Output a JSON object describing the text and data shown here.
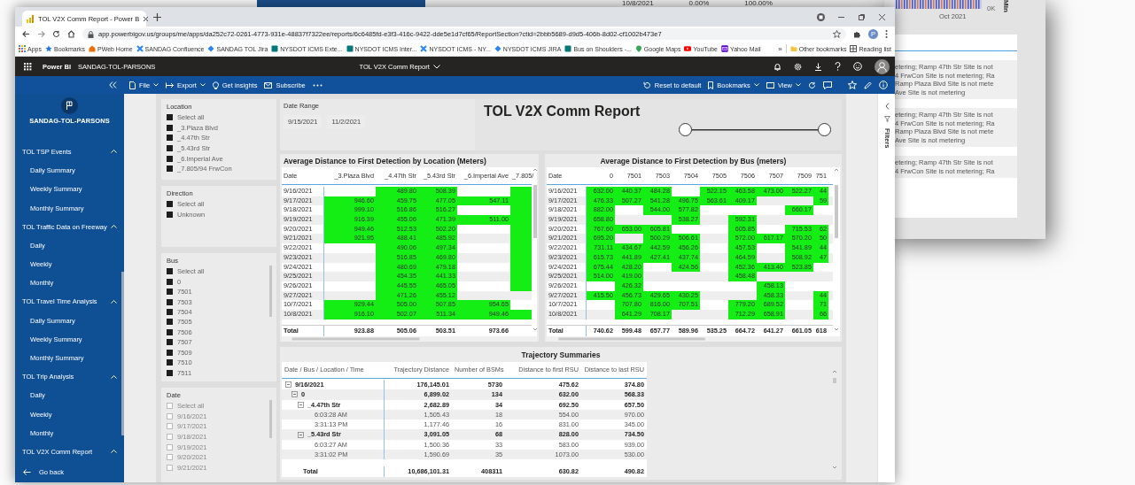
{
  "background": {
    "top_strip": [
      "10/8/2021",
      "0.00%",
      "100.00%"
    ],
    "side_panel": {
      "axis_label": "Oct 2021",
      "value_label": "0K",
      "axis_title": "Min",
      "messages": [
        [
          "etering; Ramp 47th Str Site is not",
          "4 FrwCon Site is not metering; Ra",
          "Ramp Plaza Blvd Site is not mete",
          "Ave Site is not metering"
        ],
        [
          "etering; Ramp 47th Str Site is not",
          "4 FrwCon Site is not metering; Ra",
          "Ramp Plaza Blvd Site is not mete",
          "Ave Site is not metering"
        ],
        [
          "etering; Ramp 47th Str Site is not",
          "4 FrwCon Site is not metering; Ra"
        ]
      ]
    }
  },
  "browser": {
    "tab_title": "TOL V2X Comm Report - Power B",
    "url": "app.powerbigov.us/groups/me/apps/da252c72-0261-4773-931e-48837f7322ee/reports/6c6485fd-e3f3-416c-9422-dde5e1d7cf65/ReportSection?ctid=2bbb5689-d9d5-406b-8d02-cf1002b473e7",
    "profile_initial": "P",
    "bookmarks": [
      {
        "label": "Apps",
        "kind": "grid"
      },
      {
        "label": "Bookmarks",
        "kind": "star"
      },
      {
        "label": "PWeb Home",
        "kind": "house"
      },
      {
        "label": "SANDAG Confluence",
        "kind": "cross"
      },
      {
        "label": "SANDAG TOL Jira",
        "kind": "diamond"
      },
      {
        "label": "NYSDOT ICMS Exte...",
        "kind": "tile"
      },
      {
        "label": "NYSDOT ICMS Inter...",
        "kind": "tile"
      },
      {
        "label": "NYSDOT ICMS - NY...",
        "kind": "cross"
      },
      {
        "label": "NYSDOT ICMS JIRA",
        "kind": "diamond"
      },
      {
        "label": "Bus on Shoulders -...",
        "kind": "tile"
      },
      {
        "label": "Google Maps",
        "kind": "pin"
      },
      {
        "label": "YouTube",
        "kind": "video"
      },
      {
        "label": "Yahoo Mail",
        "kind": "mail"
      }
    ],
    "more": "»",
    "bookmarks_right": [
      {
        "label": "Other bookmarks",
        "kind": "folder"
      },
      {
        "label": "Reading list",
        "kind": "list"
      }
    ]
  },
  "header": {
    "product": "Power BI",
    "workspace": "SANDAG-TOL-PARSONS",
    "report_title": "TOL V2X Comm Report"
  },
  "toolbar": {
    "left": [
      "File",
      "Export",
      "Get insights",
      "Subscribe"
    ],
    "right": [
      "Reset to default",
      "Bookmarks",
      "View"
    ]
  },
  "nav": {
    "workspace": "SANDAG-TOL-PARSONS",
    "sections": [
      {
        "label": "TOL TSP Events",
        "expanded": true,
        "children": [
          "Daily Summary",
          "Weekly Summary",
          "Monthly Summary"
        ]
      },
      {
        "label": "TOL Traffic Data on Freeway",
        "expanded": true,
        "children": [
          "Daily",
          "Weekly",
          "Monthly"
        ]
      },
      {
        "label": "TOL Travel Time Analysis",
        "expanded": true,
        "children": [
          "Daily Summary",
          "Weekly Summary",
          "Monthly Summary"
        ]
      },
      {
        "label": "TOL Trip Analysis",
        "expanded": true,
        "children": [
          "Daily",
          "Weekly",
          "Monthly"
        ]
      },
      {
        "label": "TOL V2X Comm Report",
        "expanded": true
      }
    ],
    "back": "Go back"
  },
  "slicers": [
    {
      "title": "Location",
      "items": [
        {
          "label": "Select all",
          "checked": true
        },
        {
          "label": "_3.Plaza Blvd",
          "checked": true
        },
        {
          "label": "_4.47th Str",
          "checked": true
        },
        {
          "label": "_5.43rd Str",
          "checked": true
        },
        {
          "label": "_6.Imperial Ave",
          "checked": true
        },
        {
          "label": "_7.805/94 FrwCon",
          "checked": true
        }
      ]
    },
    {
      "title": "Direction",
      "items": [
        {
          "label": "Select all",
          "checked": true
        },
        {
          "label": "Unknown",
          "checked": true
        }
      ]
    },
    {
      "title": "Bus",
      "items": [
        {
          "label": "Select all",
          "checked": true
        },
        {
          "label": "0",
          "checked": true
        },
        {
          "label": "7501",
          "checked": true
        },
        {
          "label": "7503",
          "checked": true
        },
        {
          "label": "7504",
          "checked": true
        },
        {
          "label": "7505",
          "checked": true
        },
        {
          "label": "7506",
          "checked": true
        },
        {
          "label": "7507",
          "checked": true
        },
        {
          "label": "7509",
          "checked": true
        },
        {
          "label": "7510",
          "checked": true
        },
        {
          "label": "7511",
          "checked": true
        }
      ]
    },
    {
      "title": "Date",
      "items": [
        {
          "label": "Select all",
          "checked": false
        },
        {
          "label": "9/16/2021",
          "checked": false
        },
        {
          "label": "9/17/2021",
          "checked": false
        },
        {
          "label": "9/18/2021",
          "checked": false
        },
        {
          "label": "9/19/2021",
          "checked": false
        },
        {
          "label": "9/20/2021",
          "checked": false
        },
        {
          "label": "9/21/2021",
          "checked": false
        }
      ]
    }
  ],
  "date_range": {
    "label": "Date Range",
    "start": "9/15/2021",
    "end": "11/2/2021",
    "slider": {
      "start": {
        "level": 0
      },
      "end": {
        "level": 1
      }
    }
  },
  "report_title": "TOL V2X Comm Report",
  "location_table": {
    "title": "Average Distance to First Detection by Location (Meters)",
    "date_column": "Date",
    "columns": [
      "_3.Plaza Blvd",
      "_4.47th Str",
      "_5.43rd Str",
      "_6.Imperial Ave",
      "_7.805/"
    ],
    "rows": [
      {
        "date": "9/16/2021",
        "cells": [
          {
            "highlight": false
          },
          {
            "text": "489.80",
            "highlight": true
          },
          {
            "text": "508.39",
            "highlight": true
          },
          {
            "highlight": false
          },
          {
            "highlight": true
          }
        ]
      },
      {
        "date": "9/17/2021",
        "cells": [
          {
            "text": "946.60",
            "highlight": true
          },
          {
            "text": "459.75",
            "highlight": true
          },
          {
            "text": "477.05",
            "highlight": true
          },
          {
            "text": "547.11",
            "highlight": true
          },
          {
            "highlight": true
          }
        ]
      },
      {
        "date": "9/18/2021",
        "cells": [
          {
            "text": "999.10",
            "highlight": true
          },
          {
            "text": "516.86",
            "highlight": true
          },
          {
            "text": "516.27",
            "highlight": true
          },
          {
            "highlight": false
          },
          {
            "highlight": true
          }
        ]
      },
      {
        "date": "9/19/2021",
        "cells": [
          {
            "text": "916.39",
            "highlight": true
          },
          {
            "text": "455.06",
            "highlight": true
          },
          {
            "text": "471.39",
            "highlight": true
          },
          {
            "text": "511.00",
            "highlight": true
          },
          {
            "highlight": true
          }
        ]
      },
      {
        "date": "9/20/2021",
        "cells": [
          {
            "text": "949.46",
            "highlight": true
          },
          {
            "text": "512.53",
            "highlight": true
          },
          {
            "text": "502.20",
            "highlight": true
          },
          {
            "highlight": false
          },
          {
            "highlight": true
          }
        ]
      },
      {
        "date": "9/21/2021",
        "cells": [
          {
            "text": "921.95",
            "highlight": true
          },
          {
            "text": "488.41",
            "highlight": true
          },
          {
            "text": "485.92",
            "highlight": true
          },
          {
            "highlight": false
          },
          {
            "highlight": true
          }
        ]
      },
      {
        "date": "9/22/2021",
        "cells": [
          {
            "highlight": false
          },
          {
            "text": "490.06",
            "highlight": true
          },
          {
            "text": "497.34",
            "highlight": true
          },
          {
            "highlight": false
          },
          {
            "highlight": true
          }
        ]
      },
      {
        "date": "9/23/2021",
        "cells": [
          {
            "highlight": false
          },
          {
            "text": "516.85",
            "highlight": true
          },
          {
            "text": "469.80",
            "highlight": true
          },
          {
            "highlight": false
          },
          {
            "highlight": true
          }
        ]
      },
      {
        "date": "9/24/2021",
        "cells": [
          {
            "highlight": false
          },
          {
            "text": "480.69",
            "highlight": true
          },
          {
            "text": "479.18",
            "highlight": true
          },
          {
            "highlight": false
          },
          {
            "highlight": true
          }
        ]
      },
      {
        "date": "9/25/2021",
        "cells": [
          {
            "highlight": false
          },
          {
            "text": "454.35",
            "highlight": true
          },
          {
            "text": "441.33",
            "highlight": true
          },
          {
            "highlight": false
          },
          {
            "highlight": true
          }
        ]
      },
      {
        "date": "9/26/2021",
        "cells": [
          {
            "highlight": false
          },
          {
            "text": "445.55",
            "highlight": true
          },
          {
            "text": "465.05",
            "highlight": true
          },
          {
            "highlight": false
          },
          {
            "highlight": true
          }
        ]
      },
      {
        "date": "9/27/2021",
        "cells": [
          {
            "highlight": false
          },
          {
            "text": "471.26",
            "highlight": true
          },
          {
            "text": "455.12",
            "highlight": true
          },
          {
            "highlight": false
          },
          {
            "highlight": false
          }
        ]
      },
      {
        "date": "10/7/2021",
        "cells": [
          {
            "text": "929.44",
            "highlight": true
          },
          {
            "text": "505.00",
            "highlight": true
          },
          {
            "text": "507.85",
            "highlight": true
          },
          {
            "text": "954.65",
            "highlight": true
          },
          {
            "highlight": false
          }
        ]
      },
      {
        "date": "10/8/2021",
        "cells": [
          {
            "text": "916.10",
            "highlight": true
          },
          {
            "text": "502.07",
            "highlight": true
          },
          {
            "text": "511.34",
            "highlight": true
          },
          {
            "text": "949.46",
            "highlight": true
          },
          {
            "highlight": true
          }
        ]
      }
    ],
    "total_label": "Total",
    "totals": [
      "923.88",
      "505.06",
      "503.51",
      "973.66"
    ]
  },
  "bus_table": {
    "title": "Average Distance to First Detection by Bus (meters)",
    "date_column": "Date",
    "columns": [
      "0",
      "7501",
      "7503",
      "7504",
      "7505",
      "7506",
      "7507",
      "7509",
      "751"
    ],
    "rows": [
      {
        "date": "9/16/2021",
        "cells": [
          {
            "text": "632.00",
            "highlight": true
          },
          {
            "text": "440.37",
            "highlight": true
          },
          {
            "text": "484.28",
            "highlight": true
          },
          {
            "highlight": false
          },
          {
            "text": "522.15",
            "highlight": true
          },
          {
            "text": "463.58",
            "highlight": true
          },
          {
            "text": "473.00",
            "highlight": true
          },
          {
            "text": "522.27",
            "highlight": true
          },
          {
            "text": "44",
            "highlight": true
          }
        ]
      },
      {
        "date": "9/17/2021",
        "cells": [
          {
            "text": "476.33",
            "highlight": true
          },
          {
            "text": "507.27",
            "highlight": true
          },
          {
            "text": "541.28",
            "highlight": true
          },
          {
            "text": "496.75",
            "highlight": true
          },
          {
            "text": "563.61",
            "highlight": true
          },
          {
            "text": "409.17",
            "highlight": true
          },
          {
            "highlight": false
          },
          {
            "highlight": false
          },
          {
            "text": "59",
            "highlight": true
          }
        ]
      },
      {
        "date": "9/18/2021",
        "cells": [
          {
            "text": "882.00",
            "highlight": true
          },
          {
            "highlight": false
          },
          {
            "text": "544.00",
            "highlight": true
          },
          {
            "text": "577.82",
            "highlight": true
          },
          {
            "highlight": false
          },
          {
            "highlight": false
          },
          {
            "highlight": false
          },
          {
            "text": "660.17",
            "highlight": true
          },
          {
            "highlight": false
          }
        ]
      },
      {
        "date": "9/19/2021",
        "cells": [
          {
            "text": "658.80",
            "highlight": true
          },
          {
            "highlight": false
          },
          {
            "highlight": false
          },
          {
            "text": "538.27",
            "highlight": true
          },
          {
            "highlight": false
          },
          {
            "text": "592.31",
            "highlight": true
          },
          {
            "highlight": false
          },
          {
            "highlight": false
          },
          {
            "highlight": false
          }
        ]
      },
      {
        "date": "9/20/2021",
        "cells": [
          {
            "text": "767.60",
            "highlight": true
          },
          {
            "text": "653.00",
            "highlight": true
          },
          {
            "text": "605.81",
            "highlight": true
          },
          {
            "highlight": false
          },
          {
            "highlight": false
          },
          {
            "text": "605.85",
            "highlight": true
          },
          {
            "highlight": false
          },
          {
            "text": "715.53",
            "highlight": true
          },
          {
            "text": "62",
            "highlight": true
          }
        ]
      },
      {
        "date": "9/21/2021",
        "cells": [
          {
            "text": "695.20",
            "highlight": true
          },
          {
            "highlight": false
          },
          {
            "text": "500.29",
            "highlight": true
          },
          {
            "text": "506.61",
            "highlight": true
          },
          {
            "highlight": false
          },
          {
            "text": "572.00",
            "highlight": true
          },
          {
            "text": "617.17",
            "highlight": true
          },
          {
            "text": "570.20",
            "highlight": true
          },
          {
            "text": "50",
            "highlight": true
          }
        ]
      },
      {
        "date": "9/22/2021",
        "cells": [
          {
            "text": "731.11",
            "highlight": true
          },
          {
            "text": "434.67",
            "highlight": true
          },
          {
            "text": "442.59",
            "highlight": true
          },
          {
            "text": "456.26",
            "highlight": true
          },
          {
            "highlight": false
          },
          {
            "text": "457.53",
            "highlight": true
          },
          {
            "highlight": false
          },
          {
            "text": "541.89",
            "highlight": true
          },
          {
            "text": "44",
            "highlight": true
          }
        ]
      },
      {
        "date": "9/23/2021",
        "cells": [
          {
            "text": "615.73",
            "highlight": true
          },
          {
            "text": "441.89",
            "highlight": true
          },
          {
            "text": "427.41",
            "highlight": true
          },
          {
            "text": "437.74",
            "highlight": true
          },
          {
            "highlight": false
          },
          {
            "text": "464.59",
            "highlight": true
          },
          {
            "highlight": false
          },
          {
            "text": "508.92",
            "highlight": true
          },
          {
            "text": "47",
            "highlight": true
          }
        ]
      },
      {
        "date": "9/24/2021",
        "cells": [
          {
            "text": "675.44",
            "highlight": true
          },
          {
            "text": "428.20",
            "highlight": true
          },
          {
            "highlight": false
          },
          {
            "text": "424.56",
            "highlight": true
          },
          {
            "highlight": false
          },
          {
            "text": "452.36",
            "highlight": true
          },
          {
            "text": "413.40",
            "highlight": true
          },
          {
            "text": "523.85",
            "highlight": true
          },
          {
            "highlight": false
          }
        ]
      },
      {
        "date": "9/25/2021",
        "cells": [
          {
            "text": "514.00",
            "highlight": true
          },
          {
            "text": "419.00",
            "highlight": true
          },
          {
            "highlight": false
          },
          {
            "highlight": false
          },
          {
            "highlight": false
          },
          {
            "text": "458.48",
            "highlight": true
          },
          {
            "highlight": false
          },
          {
            "highlight": false
          },
          {
            "highlight": false
          }
        ]
      },
      {
        "date": "9/26/2021",
        "cells": [
          {
            "highlight": false
          },
          {
            "text": "426.32",
            "highlight": true
          },
          {
            "highlight": false
          },
          {
            "highlight": false
          },
          {
            "highlight": false
          },
          {
            "highlight": false
          },
          {
            "text": "458.13",
            "highlight": true
          },
          {
            "highlight": false
          },
          {
            "highlight": false
          }
        ]
      },
      {
        "date": "9/27/2021",
        "cells": [
          {
            "text": "415.50",
            "highlight": true
          },
          {
            "text": "456.73",
            "highlight": true
          },
          {
            "text": "429.65",
            "highlight": true
          },
          {
            "text": "430.25",
            "highlight": true
          },
          {
            "highlight": false
          },
          {
            "highlight": false
          },
          {
            "text": "458.33",
            "highlight": true
          },
          {
            "highlight": false
          },
          {
            "text": "44",
            "highlight": true
          }
        ]
      },
      {
        "date": "10/7/2021",
        "cells": [
          {
            "highlight": false
          },
          {
            "text": "707.80",
            "highlight": true
          },
          {
            "text": "816.00",
            "highlight": true
          },
          {
            "text": "707.51",
            "highlight": true
          },
          {
            "highlight": false
          },
          {
            "text": "779.20",
            "highlight": true
          },
          {
            "text": "689.52",
            "highlight": true
          },
          {
            "highlight": false
          },
          {
            "text": "71",
            "highlight": true
          }
        ]
      },
      {
        "date": "10/8/2021",
        "cells": [
          {
            "highlight": false
          },
          {
            "text": "641.29",
            "highlight": true
          },
          {
            "text": "708.17",
            "highlight": true
          },
          {
            "highlight": false
          },
          {
            "highlight": false
          },
          {
            "text": "712.29",
            "highlight": true
          },
          {
            "text": "658.91",
            "highlight": true
          },
          {
            "highlight": false
          },
          {
            "text": "66",
            "highlight": true
          }
        ]
      }
    ],
    "total_label": "Total",
    "totals": [
      "740.62",
      "599.48",
      "657.77",
      "589.96",
      "535.25",
      "664.72",
      "641.27",
      "661.05",
      "618"
    ]
  },
  "trajectory": {
    "title": "Trajectory Summaries",
    "label_column": "Date / Bus / Location / Time",
    "columns": [
      "Trajectory Distance",
      "Number of BSMs",
      "Distance to first RSU",
      "Distance to last RSU"
    ],
    "rows": [
      {
        "label": "9/16/2021",
        "values": [
          "176,145.01",
          "5730",
          "475.62",
          "374.80"
        ],
        "expanded": true,
        "children": [
          {
            "label": "0",
            "values": [
              "6,899.02",
              "134",
              "632.00",
              "568.33"
            ],
            "expanded": true,
            "children": [
              {
                "label": "_4.47th Str",
                "values": [
                  "2,682.89",
                  "34",
                  "692.50",
                  "657.50"
                ],
                "expanded": true,
                "children": [
                  {
                    "label": "6:03:28 AM",
                    "values": [
                      "1,505.43",
                      "18",
                      "554.00",
                      "970.00"
                    ]
                  },
                  {
                    "label": "3:31:13 PM",
                    "values": [
                      "1,177.46",
                      "16",
                      "831.00",
                      "345.00"
                    ]
                  }
                ]
              },
              {
                "label": "_5.43rd Str",
                "values": [
                  "3,091.05",
                  "68",
                  "828.00",
                  "734.50"
                ],
                "expanded": true,
                "children": [
                  {
                    "label": "6:03:27 AM",
                    "values": [
                      "1,500.36",
                      "33",
                      "583.00",
                      "939.00"
                    ]
                  },
                  {
                    "label": "3:31:02 PM",
                    "values": [
                      "1,590.69",
                      "35",
                      "1073.00",
                      "530.00"
                    ]
                  }
                ]
              }
            ]
          }
        ]
      }
    ],
    "total_label": "Total",
    "totals": [
      "10,686,101.31",
      "408311",
      "630.82",
      "490.82"
    ]
  },
  "filters_label": "Filters"
}
